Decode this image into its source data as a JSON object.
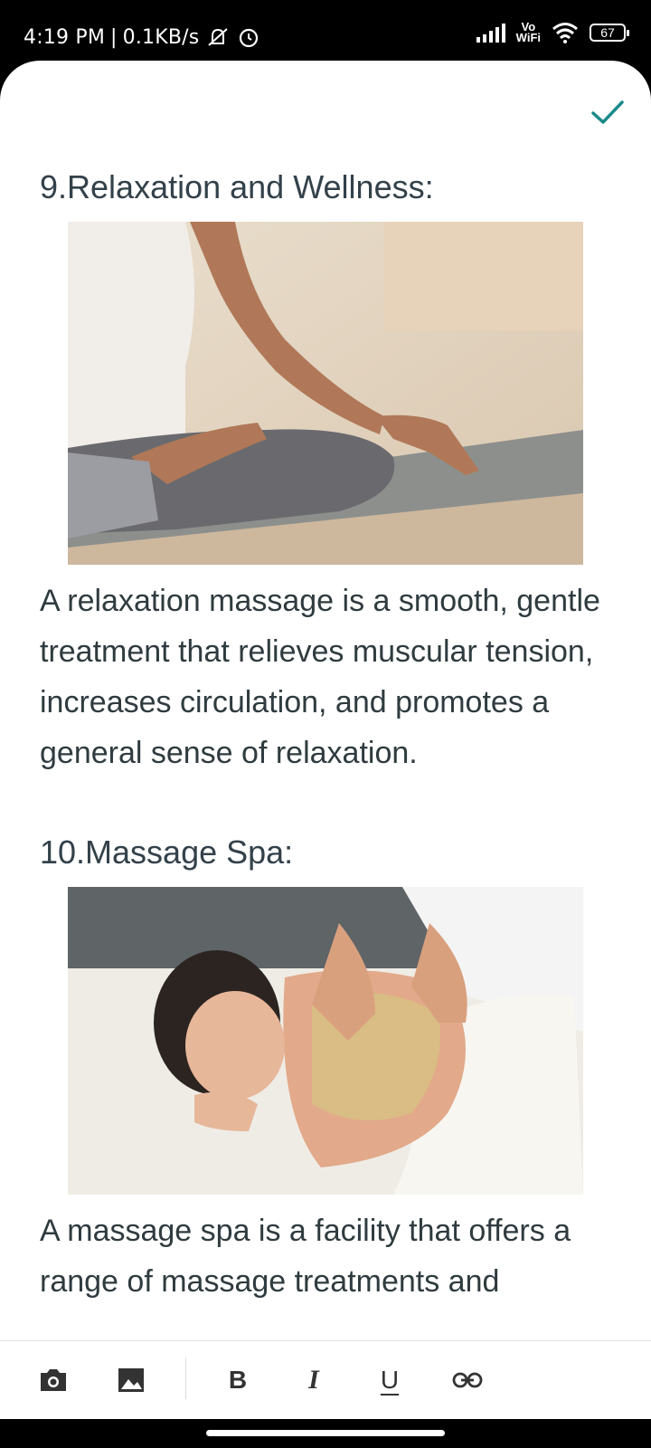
{
  "status": {
    "time": "4:19 PM",
    "speed": "0.1KB/s",
    "vowifi_top": "Vo",
    "vowifi_bottom": "WiFi",
    "battery": "67"
  },
  "header": {
    "confirm_icon": "check-icon"
  },
  "sections": [
    {
      "heading": "9.Relaxation and Wellness:",
      "image": "yoga-meditation-photo",
      "text": "A relaxation massage is a smooth, gentle treatment that relieves muscular tension, increases circulation, and promotes a general sense of relaxation."
    },
    {
      "heading": "10.Massage Spa:",
      "image": "spa-massage-photo",
      "text": "A massage spa is a facility that offers a range of massage treatments and"
    }
  ],
  "toolbar": {
    "camera": "camera-icon",
    "image": "image-icon",
    "bold": "B",
    "italic": "I",
    "underline": "U",
    "link": "link-icon"
  },
  "colors": {
    "accent": "#1a8a8a",
    "text": "#2f3b3f"
  }
}
